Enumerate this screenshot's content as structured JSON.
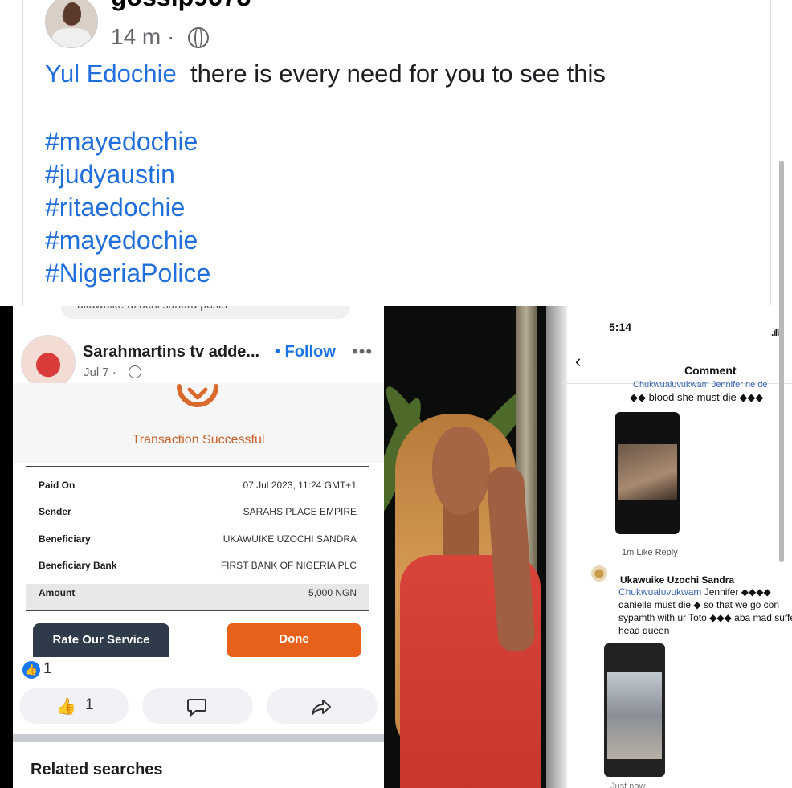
{
  "post": {
    "username": "gossip9678",
    "time": "14 m ·",
    "mention": "Yul Edochie",
    "text": "there is every need for you to see this",
    "hashtags": [
      "#mayedochie",
      "#judyaustin",
      "#ritaedochie",
      "#mayedochie",
      "#NigeriaPolice"
    ]
  },
  "screenshot1": {
    "search_text": "ukawuike uzochi sandra posts",
    "author": "Sarahmartins tv adde...",
    "follow": "• Follow",
    "more": "•••",
    "date": "Jul 7 ·",
    "status": "Transaction Successful",
    "receipt": [
      {
        "label": "Paid On",
        "value": "07 Jul 2023, 11:24 GMT+1"
      },
      {
        "label": "Sender",
        "value": "SARAHS PLACE EMPIRE"
      },
      {
        "label": "Beneficiary",
        "value": "UKAWUIKE UZOCHI SANDRA"
      },
      {
        "label": "Beneficiary Bank",
        "value": "FIRST BANK OF NIGERIA PLC"
      },
      {
        "label": "Amount",
        "value": "5,000 NGN"
      }
    ],
    "rate_button": "Rate Our Service",
    "done_button": "Done",
    "like_count": "1",
    "like_button_count": "1",
    "related_searches": "Related searches"
  },
  "screenshot3": {
    "time": "5:14",
    "signal": ".ıll",
    "title": "Comment",
    "partial_top": "Chukwualuvukwam Jennifer ne de",
    "blood_text": "◆◆ blood she must die ◆◆◆",
    "comment_actions": "1m   Like   Reply",
    "commenter": "Ukawuike Uzochi Sandra",
    "mention": "Chukwualuvukwam",
    "comment_text": "Jennifer ◆◆◆◆ danielle must die ◆ so that we go con sypamth with ur Toto ◆◆◆ aba mad suffer head queen",
    "just_now": "Just now"
  },
  "colors": {
    "link": "#216fdb",
    "accent": "#e8611a",
    "dark_button": "#2f3b4a",
    "facebook_blue": "#1877f2"
  }
}
